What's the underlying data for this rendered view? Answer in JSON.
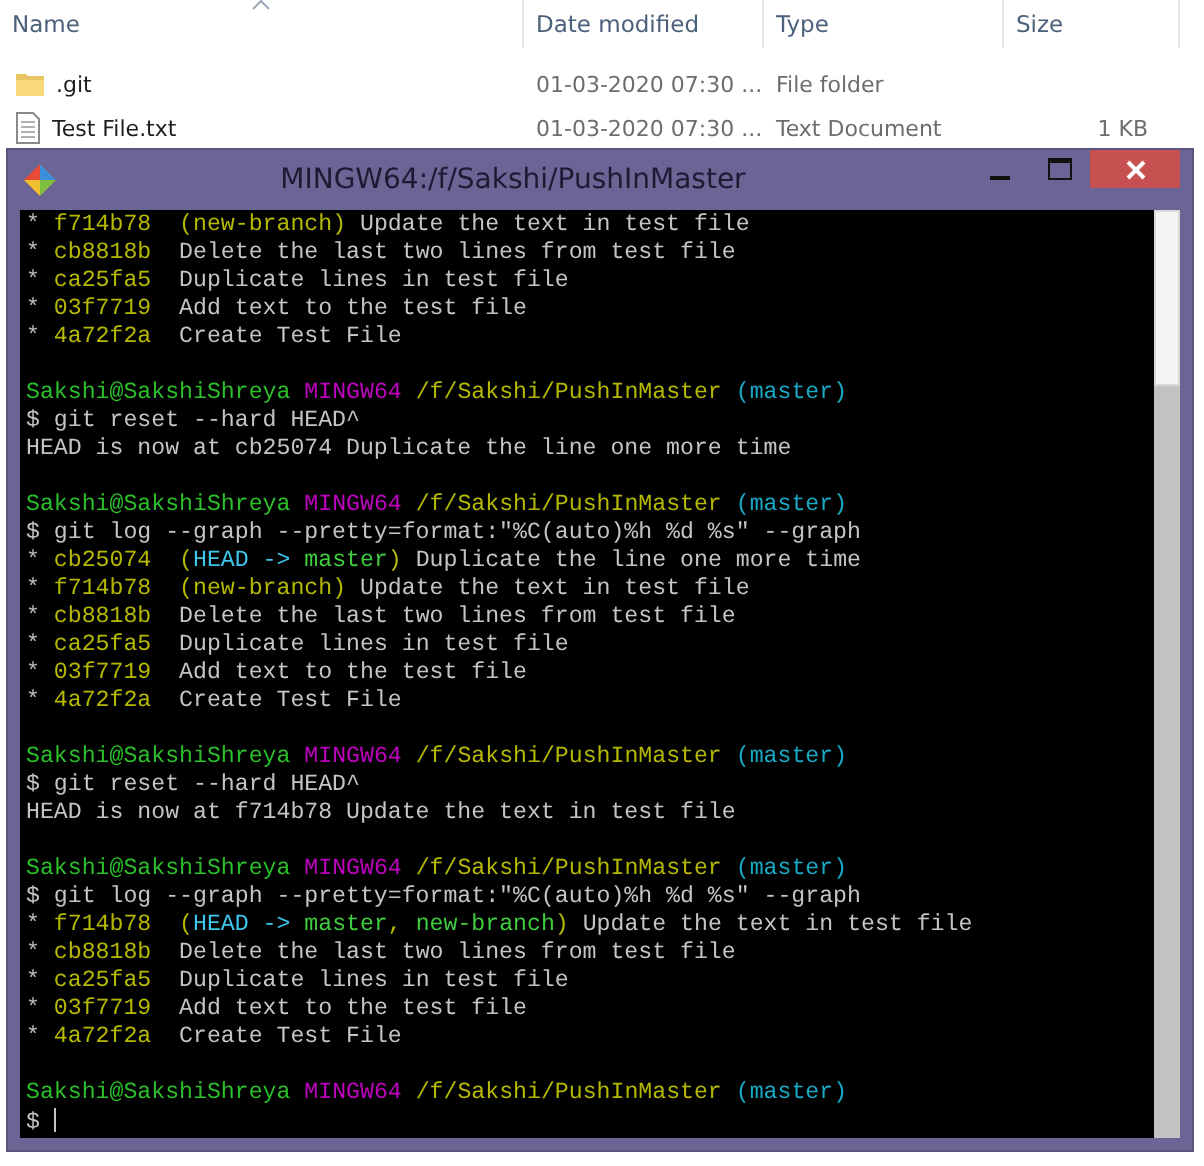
{
  "explorer": {
    "columns": [
      "Name",
      "Date modified",
      "Type",
      "Size"
    ],
    "files": [
      {
        "kind": "folder",
        "name": ".git",
        "date": "01-03-2020 07:30 ...",
        "type": "File folder"
      },
      {
        "kind": "text-file",
        "name": "Test File.txt",
        "date": "01-03-2020 07:30 ...",
        "type": "Text Document",
        "size": "1 KB"
      }
    ]
  },
  "terminal": {
    "title": "MINGW64:/f/Sakshi/PushInMaster",
    "lines": [
      {
        "kind": "output",
        "segments": [
          {
            "kind": "graph",
            "text": "* "
          },
          {
            "kind": "hash",
            "text": "f714b78"
          },
          {
            "kind": "ref",
            "text": "  (new-branch)"
          },
          {
            "kind": "text",
            "text": " Update the text in test file"
          }
        ]
      },
      {
        "kind": "output",
        "segments": [
          {
            "kind": "graph",
            "text": "* "
          },
          {
            "kind": "hash",
            "text": "cb8818b"
          },
          {
            "kind": "text",
            "text": "  Delete the last two lines from test file"
          }
        ]
      },
      {
        "kind": "output",
        "segments": [
          {
            "kind": "graph",
            "text": "* "
          },
          {
            "kind": "hash",
            "text": "ca25fa5"
          },
          {
            "kind": "text",
            "text": "  Duplicate lines in test file"
          }
        ]
      },
      {
        "kind": "output",
        "segments": [
          {
            "kind": "graph",
            "text": "* "
          },
          {
            "kind": "hash",
            "text": "03f7719"
          },
          {
            "kind": "text",
            "text": "  Add text to the test file"
          }
        ]
      },
      {
        "kind": "output",
        "segments": [
          {
            "kind": "graph",
            "text": "* "
          },
          {
            "kind": "hash",
            "text": "4a72f2a"
          },
          {
            "kind": "text",
            "text": "  Create Test File"
          }
        ]
      },
      {
        "kind": "blank"
      },
      {
        "kind": "prompt",
        "segments": [
          {
            "kind": "user",
            "text": "Sakshi@SakshiShreya"
          },
          {
            "kind": "system",
            "text": " MINGW64"
          },
          {
            "kind": "path",
            "text": " /f/Sakshi/PushInMaster"
          },
          {
            "kind": "prompt-branch",
            "text": " (master)"
          }
        ]
      },
      {
        "kind": "command",
        "segments": [
          {
            "kind": "text",
            "text": "$ git reset --hard HEAD^"
          }
        ]
      },
      {
        "kind": "output",
        "segments": [
          {
            "kind": "text",
            "text": "HEAD is now at cb25074 Duplicate the line one more time"
          }
        ]
      },
      {
        "kind": "blank"
      },
      {
        "kind": "prompt",
        "segments": [
          {
            "kind": "user",
            "text": "Sakshi@SakshiShreya"
          },
          {
            "kind": "system",
            "text": " MINGW64"
          },
          {
            "kind": "path",
            "text": " /f/Sakshi/PushInMaster"
          },
          {
            "kind": "prompt-branch",
            "text": " (master)"
          }
        ]
      },
      {
        "kind": "command",
        "segments": [
          {
            "kind": "text",
            "text": "$ git log --graph --pretty=format:\"%C(auto)%h %d %s\" --graph"
          }
        ]
      },
      {
        "kind": "output",
        "segments": [
          {
            "kind": "graph",
            "text": "* "
          },
          {
            "kind": "hash",
            "text": "cb25074"
          },
          {
            "kind": "ref",
            "text": "  ("
          },
          {
            "kind": "head",
            "text": "HEAD -> "
          },
          {
            "kind": "branch",
            "text": "master"
          },
          {
            "kind": "ref",
            "text": ")"
          },
          {
            "kind": "text",
            "text": " Duplicate the line one more time"
          }
        ]
      },
      {
        "kind": "output",
        "segments": [
          {
            "kind": "graph",
            "text": "* "
          },
          {
            "kind": "hash",
            "text": "f714b78"
          },
          {
            "kind": "ref",
            "text": "  (new-branch)"
          },
          {
            "kind": "text",
            "text": " Update the text in test file"
          }
        ]
      },
      {
        "kind": "output",
        "segments": [
          {
            "kind": "graph",
            "text": "* "
          },
          {
            "kind": "hash",
            "text": "cb8818b"
          },
          {
            "kind": "text",
            "text": "  Delete the last two lines from test file"
          }
        ]
      },
      {
        "kind": "output",
        "segments": [
          {
            "kind": "graph",
            "text": "* "
          },
          {
            "kind": "hash",
            "text": "ca25fa5"
          },
          {
            "kind": "text",
            "text": "  Duplicate lines in test file"
          }
        ]
      },
      {
        "kind": "output",
        "segments": [
          {
            "kind": "graph",
            "text": "* "
          },
          {
            "kind": "hash",
            "text": "03f7719"
          },
          {
            "kind": "text",
            "text": "  Add text to the test file"
          }
        ]
      },
      {
        "kind": "output",
        "segments": [
          {
            "kind": "graph",
            "text": "* "
          },
          {
            "kind": "hash",
            "text": "4a72f2a"
          },
          {
            "kind": "text",
            "text": "  Create Test File"
          }
        ]
      },
      {
        "kind": "blank"
      },
      {
        "kind": "prompt",
        "segments": [
          {
            "kind": "user",
            "text": "Sakshi@SakshiShreya"
          },
          {
            "kind": "system",
            "text": " MINGW64"
          },
          {
            "kind": "path",
            "text": " /f/Sakshi/PushInMaster"
          },
          {
            "kind": "prompt-branch",
            "text": " (master)"
          }
        ]
      },
      {
        "kind": "command",
        "segments": [
          {
            "kind": "text",
            "text": "$ git reset --hard HEAD^"
          }
        ]
      },
      {
        "kind": "output",
        "segments": [
          {
            "kind": "text",
            "text": "HEAD is now at f714b78 Update the text in test file"
          }
        ]
      },
      {
        "kind": "blank"
      },
      {
        "kind": "prompt",
        "segments": [
          {
            "kind": "user",
            "text": "Sakshi@SakshiShreya"
          },
          {
            "kind": "system",
            "text": " MINGW64"
          },
          {
            "kind": "path",
            "text": " /f/Sakshi/PushInMaster"
          },
          {
            "kind": "prompt-branch",
            "text": " (master)"
          }
        ]
      },
      {
        "kind": "command",
        "segments": [
          {
            "kind": "text",
            "text": "$ git log --graph --pretty=format:\"%C(auto)%h %d %s\" --graph"
          }
        ]
      },
      {
        "kind": "output",
        "segments": [
          {
            "kind": "graph",
            "text": "* "
          },
          {
            "kind": "hash",
            "text": "f714b78"
          },
          {
            "kind": "ref",
            "text": "  ("
          },
          {
            "kind": "head",
            "text": "HEAD -> "
          },
          {
            "kind": "branch",
            "text": "master"
          },
          {
            "kind": "ref",
            "text": ", "
          },
          {
            "kind": "branch",
            "text": "new-branch"
          },
          {
            "kind": "ref",
            "text": ")"
          },
          {
            "kind": "text",
            "text": " Update the text in test file"
          }
        ]
      },
      {
        "kind": "output",
        "segments": [
          {
            "kind": "graph",
            "text": "* "
          },
          {
            "kind": "hash",
            "text": "cb8818b"
          },
          {
            "kind": "text",
            "text": "  Delete the last two lines from test file"
          }
        ]
      },
      {
        "kind": "output",
        "segments": [
          {
            "kind": "graph",
            "text": "* "
          },
          {
            "kind": "hash",
            "text": "ca25fa5"
          },
          {
            "kind": "text",
            "text": "  Duplicate lines in test file"
          }
        ]
      },
      {
        "kind": "output",
        "segments": [
          {
            "kind": "graph",
            "text": "* "
          },
          {
            "kind": "hash",
            "text": "03f7719"
          },
          {
            "kind": "text",
            "text": "  Add text to the test file"
          }
        ]
      },
      {
        "kind": "output",
        "segments": [
          {
            "kind": "graph",
            "text": "* "
          },
          {
            "kind": "hash",
            "text": "4a72f2a"
          },
          {
            "kind": "text",
            "text": "  Create Test File"
          }
        ]
      },
      {
        "kind": "blank"
      },
      {
        "kind": "prompt",
        "segments": [
          {
            "kind": "user",
            "text": "Sakshi@SakshiShreya"
          },
          {
            "kind": "system",
            "text": " MINGW64"
          },
          {
            "kind": "path",
            "text": " /f/Sakshi/PushInMaster"
          },
          {
            "kind": "prompt-branch",
            "text": " (master)"
          }
        ]
      },
      {
        "kind": "command",
        "cursor": true,
        "segments": [
          {
            "kind": "text",
            "text": "$"
          }
        ]
      }
    ]
  }
}
